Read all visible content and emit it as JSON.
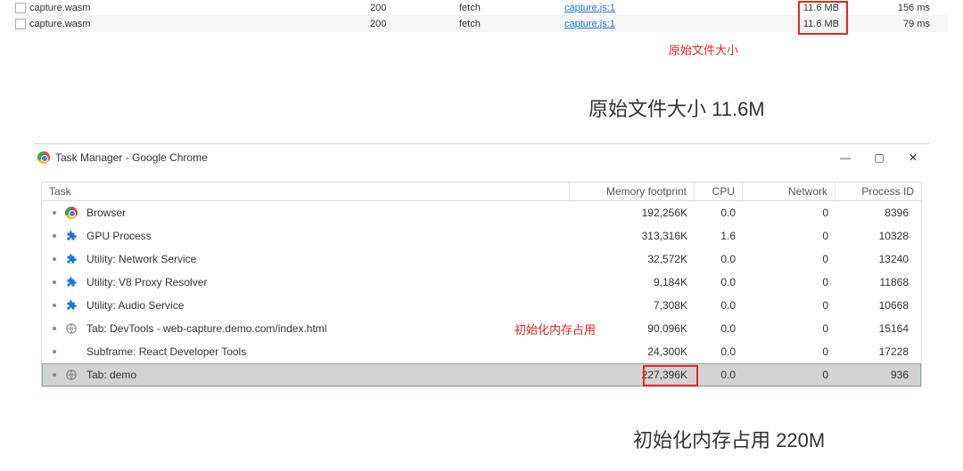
{
  "network": {
    "rows": [
      {
        "name": "capture.wasm",
        "status": "200",
        "type": "fetch",
        "initiator": "capture.js:1",
        "size": "11.6 MB",
        "time": "156 ms"
      },
      {
        "name": "capture.wasm",
        "status": "200",
        "type": "fetch",
        "initiator": "capture.js:1",
        "size": "11.6 MB",
        "time": "79 ms"
      }
    ]
  },
  "annotation_file_size_label": "原始文件大小",
  "caption_file_size": "原始文件大小 11.6M",
  "task_manager": {
    "title": "Task Manager - Google Chrome",
    "columns": {
      "task": "Task",
      "mem": "Memory footprint",
      "cpu": "CPU",
      "net": "Network",
      "pid": "Process ID"
    },
    "rows": [
      {
        "icon": "chrome",
        "name": "Browser",
        "mem": "192,256K",
        "cpu": "0.0",
        "net": "0",
        "pid": "8396",
        "sel": false
      },
      {
        "icon": "puzzle",
        "name": "GPU Process",
        "mem": "313,316K",
        "cpu": "1.6",
        "net": "0",
        "pid": "10328",
        "sel": false
      },
      {
        "icon": "puzzle",
        "name": "Utility: Network Service",
        "mem": "32,572K",
        "cpu": "0.0",
        "net": "0",
        "pid": "13240",
        "sel": false
      },
      {
        "icon": "puzzle",
        "name": "Utility: V8 Proxy Resolver",
        "mem": "9,184K",
        "cpu": "0.0",
        "net": "0",
        "pid": "11868",
        "sel": false
      },
      {
        "icon": "puzzle",
        "name": "Utility: Audio Service",
        "mem": "7,308K",
        "cpu": "0.0",
        "net": "0",
        "pid": "10668",
        "sel": false
      },
      {
        "icon": "globe",
        "name": "Tab: DevTools - web-capture.demo.com/index.html",
        "mem": "90,096K",
        "cpu": "0.0",
        "net": "0",
        "pid": "15164",
        "sel": false
      },
      {
        "icon": "none",
        "name": "Subframe: React Developer Tools",
        "mem": "24,300K",
        "cpu": "0.0",
        "net": "0",
        "pid": "17228",
        "sel": false
      },
      {
        "icon": "globe",
        "name": "Tab: demo",
        "mem": "227,396K",
        "cpu": "0.0",
        "net": "0",
        "pid": "936",
        "sel": true
      }
    ],
    "init_annotation": "初始化内存占用"
  },
  "caption_memory": "初始化内存占用 220M"
}
